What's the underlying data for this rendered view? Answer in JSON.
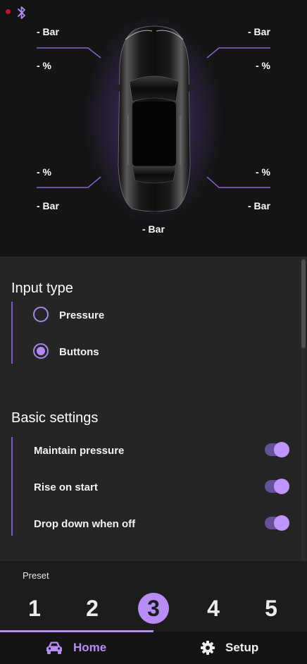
{
  "status": {
    "connection_indicator_color": "#c4122e",
    "bluetooth_icon": "bluetooth-icon"
  },
  "tires": {
    "front_left": {
      "pressure": "- Bar",
      "percent": "- %"
    },
    "front_right": {
      "pressure": "- Bar",
      "percent": "- %"
    },
    "rear_left": {
      "pressure": "- Bar",
      "percent": "- %"
    },
    "rear_right": {
      "pressure": "- Bar",
      "percent": "- %"
    },
    "tank": {
      "pressure": "- Bar"
    }
  },
  "input_type": {
    "title": "Input type",
    "options": [
      {
        "label": "Pressure",
        "selected": false
      },
      {
        "label": "Buttons",
        "selected": true
      }
    ]
  },
  "basic_settings": {
    "title": "Basic settings",
    "items": [
      {
        "label": "Maintain pressure",
        "on": true
      },
      {
        "label": "Rise on start",
        "on": true
      },
      {
        "label": "Drop down when off",
        "on": true
      }
    ]
  },
  "preset": {
    "title": "Preset",
    "numbers": [
      "1",
      "2",
      "3",
      "4",
      "5"
    ],
    "active": "3"
  },
  "nav": {
    "home_label": "Home",
    "setup_label": "Setup",
    "active": "Home",
    "accent_color": "#b88cf7"
  }
}
